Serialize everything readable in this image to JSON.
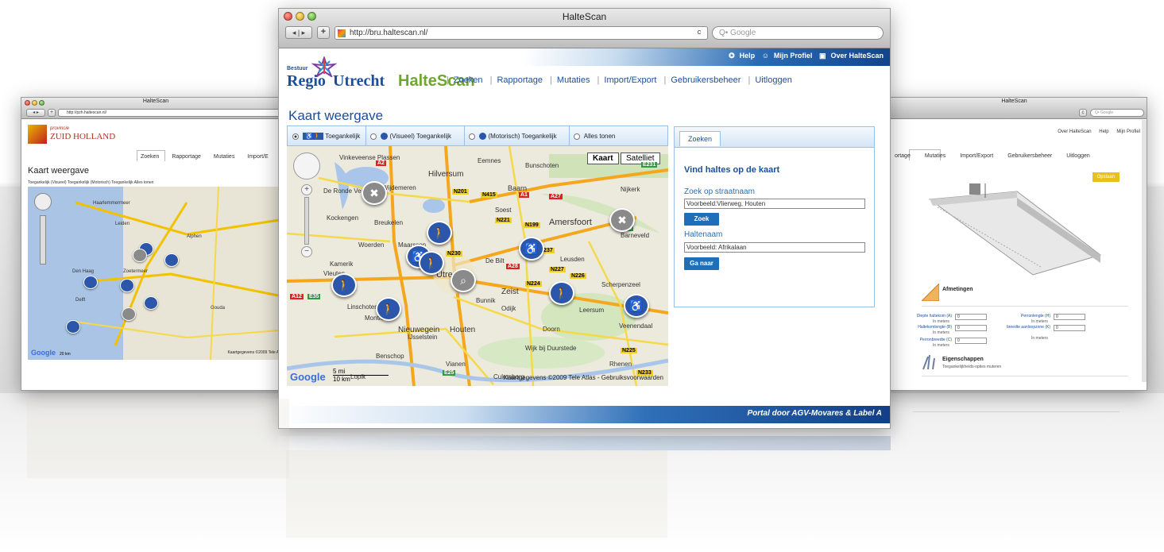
{
  "main": {
    "window_title": "HalteScan",
    "url": "http://bru.haltescan.nl/",
    "search_placeholder": "Q• Google",
    "top_links": [
      "Help",
      "Mijn Profiel",
      "Over HalteScan"
    ],
    "logo": {
      "bestuur": "Bestuur",
      "regio": "Regio",
      "utrecht": "Utrecht",
      "app": "HalteScan"
    },
    "nav": [
      "Zoeken",
      "Rapportage",
      "Mutaties",
      "Import/Export",
      "Gebruikersbeheer",
      "Uitloggen"
    ],
    "page_title": "Kaart weergave",
    "filters": [
      {
        "label": "Toegankelijk",
        "selected": true
      },
      {
        "label": "(Visueel) Toegankelijk",
        "selected": false
      },
      {
        "label": "(Motorisch) Toegankelijk",
        "selected": false
      },
      {
        "label": "Alles tonen",
        "selected": false
      }
    ],
    "map": {
      "toggle_map": "Kaart",
      "toggle_sat": "Satelliet",
      "places": [
        "Vinkeveense Plassen",
        "Hilversum",
        "Eemnes",
        "Bunschoten",
        "Nijkerk",
        "Wijdemeren",
        "Baarn",
        "De Ronde Venen",
        "Breukelen",
        "Soest",
        "Amersfoort",
        "Barneveld",
        "Woerden",
        "Maarssen",
        "Leusden",
        "Utrecht",
        "De Bilt",
        "Zeist",
        "Scherpenzeel",
        "Kamerik",
        "Linschoten",
        "Bunnik",
        "Odijk",
        "Montfoort",
        "Nieuwegein",
        "Houten",
        "Doorn",
        "Veenendaal",
        "IJsselstein",
        "Leersum",
        "Benschop",
        "Vianen",
        "Lopik",
        "Wijk bij Duurstede",
        "Culemborg",
        "Rhenen",
        "Kockengen",
        "Vleuten"
      ],
      "roads": [
        "A2",
        "A1",
        "A27",
        "A28",
        "A12",
        "E35",
        "E30",
        "E25",
        "N201",
        "N415",
        "N221",
        "N199",
        "N237",
        "N230",
        "N227",
        "N224",
        "N226",
        "N225",
        "N233",
        "E231"
      ],
      "google": "Google",
      "scale": [
        "5 mi",
        "10 km"
      ],
      "copyright": "Kaartgegevens ©2009 Tele Atlas - Gebruiksvoorwaarden"
    },
    "search_panel": {
      "tab": "Zoeken",
      "heading": "Vind haltes op de kaart",
      "street_label": "Zoek op straatnaam",
      "street_value": "Voorbeeld:Vlierweg, Houten",
      "search_button": "Zoek",
      "stop_label": "Haltenaam",
      "stop_value": "Voorbeeld: Afrikalaan",
      "go_button": "Ga naar"
    },
    "footer": "Portal door AGV-Movares & Label A"
  },
  "left": {
    "window_title": "HalteScan",
    "url": "http://pzh.haltescan.nl/",
    "logo": {
      "prov": "provincie",
      "name": "ZUID HOLLAND"
    },
    "nav": [
      "Zoeken",
      "Rapportage",
      "Mutaties",
      "Import/E"
    ],
    "page_title": "Kaart weergave",
    "filter_text": "Toegankelijk  (Visueel) Toegankelijk  (Motorisch) Toegankelijk  Alles tonen",
    "places": [
      "Haarlemmermeer",
      "Den Haag",
      "Zoetermeer",
      "Delft",
      "Alphen",
      "Gouda",
      "Leiden"
    ],
    "google": "Google",
    "scale": "20 km",
    "copyright": "Kaartgegevens ©2009 Tele Atlas"
  },
  "right": {
    "window_title": "HalteScan",
    "search_placeholder": "Q• Google",
    "top_links": [
      "Over HalteScan",
      "Help",
      "Mijn Profiel"
    ],
    "nav": [
      "ortage",
      "Mutaties",
      "Import/Export",
      "Gebruikersbeheer",
      "Uitloggen"
    ],
    "save_button": "Opslaan",
    "section_dimensions": "Afmetingen",
    "fields_left": [
      {
        "label": "Diepte haltekom (A)",
        "unit": "In meters",
        "value": "0"
      },
      {
        "label": "Haltekomlengte (B)",
        "unit": "In meters",
        "value": "0"
      },
      {
        "label": "Perronbreedte (C)",
        "unit": "In meters",
        "value": "0"
      }
    ],
    "fields_right": [
      {
        "label": "Perronlengte (H)",
        "unit": "In meters",
        "value": "0"
      },
      {
        "label": "breedte aanloopzone (K)",
        "unit": "In meters",
        "value": "0"
      }
    ],
    "section_properties": "Eigenschappen",
    "properties_sub": "Toegankelijkheids-opties muteren"
  },
  "colors": {
    "brand_blue": "#1b4f9b",
    "brand_green": "#6fa632",
    "pin_blue": "#2b56a9",
    "button_blue": "#1e6fb9"
  }
}
